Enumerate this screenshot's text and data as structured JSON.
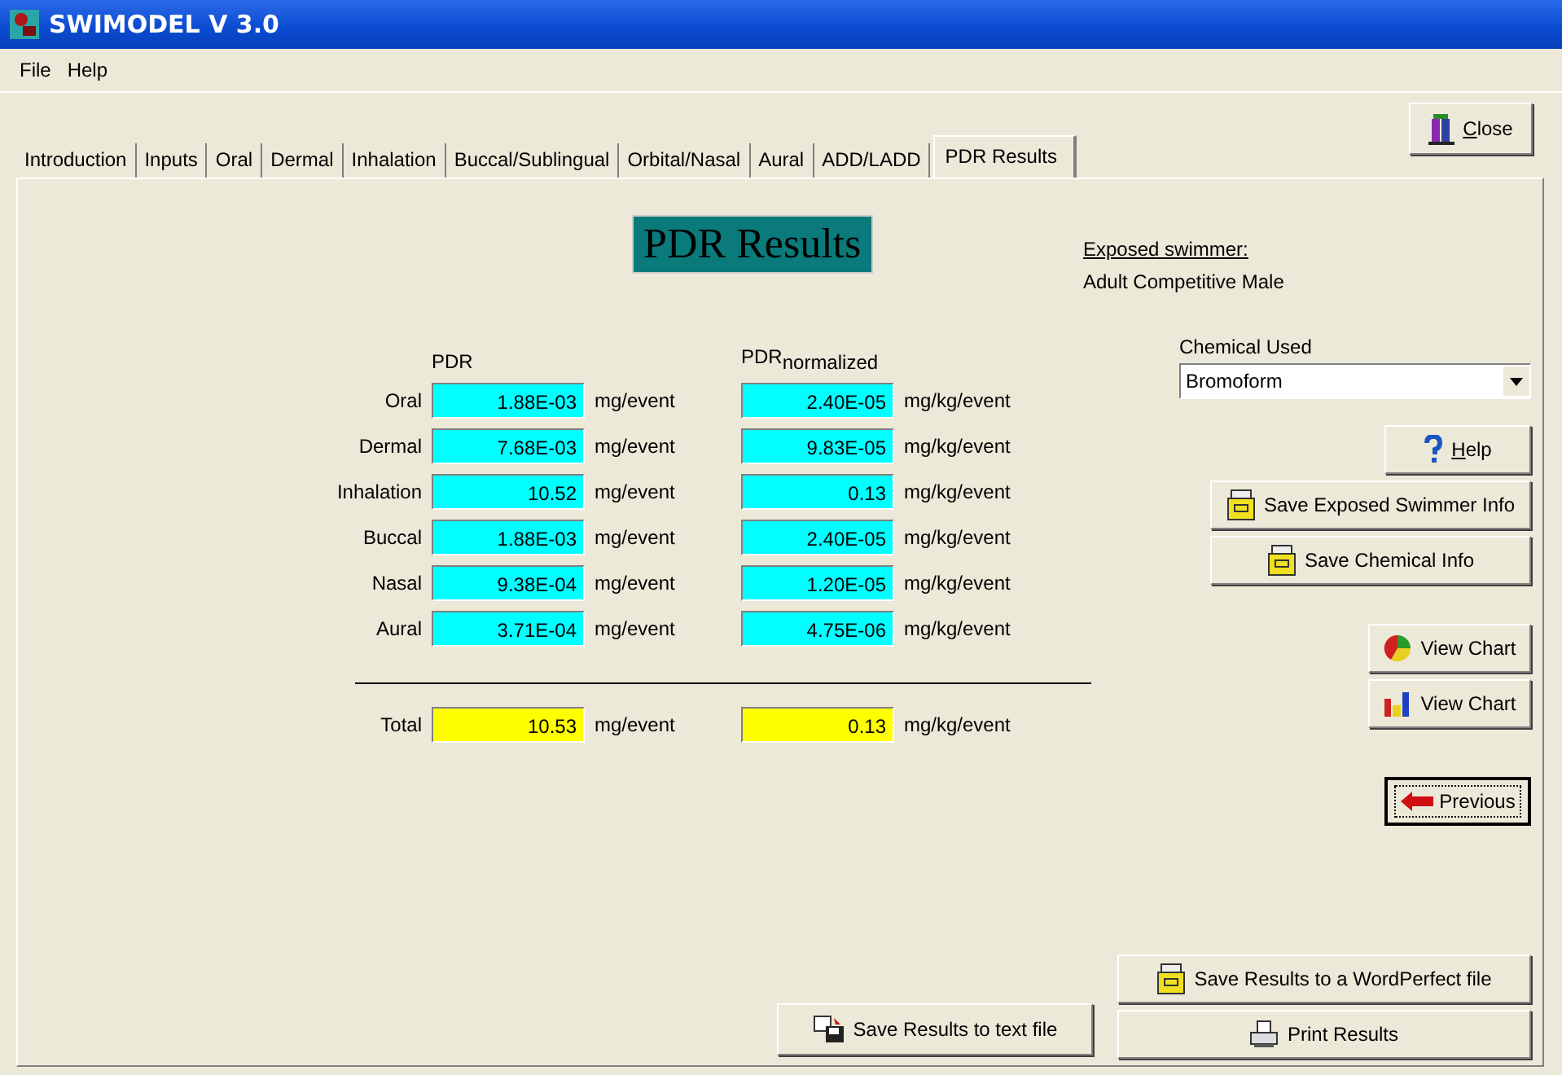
{
  "window": {
    "title": "SWIMODEL V 3.0"
  },
  "menu": [
    "File",
    "Help"
  ],
  "close_button": "Close",
  "tabs": [
    {
      "label": "Introduction",
      "selected": false
    },
    {
      "label": "Inputs",
      "selected": false
    },
    {
      "label": "Oral",
      "selected": false
    },
    {
      "label": "Dermal",
      "selected": false
    },
    {
      "label": "Inhalation",
      "selected": false
    },
    {
      "label": "Buccal/Sublingual",
      "selected": false
    },
    {
      "label": "Orbital/Nasal",
      "selected": false
    },
    {
      "label": "Aural",
      "selected": false
    },
    {
      "label": "ADD/LADD",
      "selected": false
    },
    {
      "label": "PDR Results",
      "selected": true
    }
  ],
  "heading": "PDR Results",
  "swimmer": {
    "label": "Exposed swimmer:",
    "value": "Adult Competitive Male"
  },
  "chemical": {
    "label": "Chemical Used",
    "value": "Bromoform"
  },
  "help_button": "Help",
  "columns": {
    "pdr": "PDR",
    "pdr_normalized": "PDR$_{normalized}$"
  },
  "rows": [
    {
      "name": "Oral",
      "pdr": "1.88E-03",
      "pdr_unit": "mg/event",
      "normalized": "2.40E-05",
      "normalized_unit": "mg/kg/event"
    },
    {
      "name": "Dermal",
      "pdr": "7.68E-03",
      "pdr_unit": "mg/event",
      "normalized": "9.83E-05",
      "normalized_unit": "mg/kg/event"
    },
    {
      "name": "Inhalation",
      "pdr": "10.52",
      "pdr_unit": "mg/event",
      "normalized": "0.13",
      "normalized_unit": "mg/kg/event"
    },
    {
      "name": "Buccal",
      "pdr": "1.88E-03",
      "pdr_unit": "mg/event",
      "normalized": "2.40E-05",
      "normalized_unit": "mg/kg/event"
    },
    {
      "name": "Nasal",
      "pdr": "9.38E-04",
      "pdr_unit": "mg/event",
      "normalized": "1.20E-05",
      "normalized_unit": "mg/kg/event"
    },
    {
      "name": "Aural",
      "pdr": "3.71E-04",
      "pdr_unit": "mg/event",
      "normalized": "4.75E-06",
      "normalized_unit": "mg/kg/event"
    }
  ],
  "total": {
    "name": "Total",
    "pdr": "10.53",
    "pdr_unit": "mg/event",
    "normalized": "0.13",
    "normalized_unit": "mg/kg/event"
  },
  "save_buttons": [
    "Save Exposed Swimmer Info",
    "Save Chemical Info"
  ],
  "chart_buttons": [
    {
      "label": "View Chart",
      "kind": "pie"
    },
    {
      "label": "View Chart",
      "kind": "bar"
    }
  ],
  "previous_button": "Previous",
  "wordperfect_button": "Save Results to a WordPerfect file",
  "text_file_button": "Save Results to text file",
  "print_button": "Print Results"
}
